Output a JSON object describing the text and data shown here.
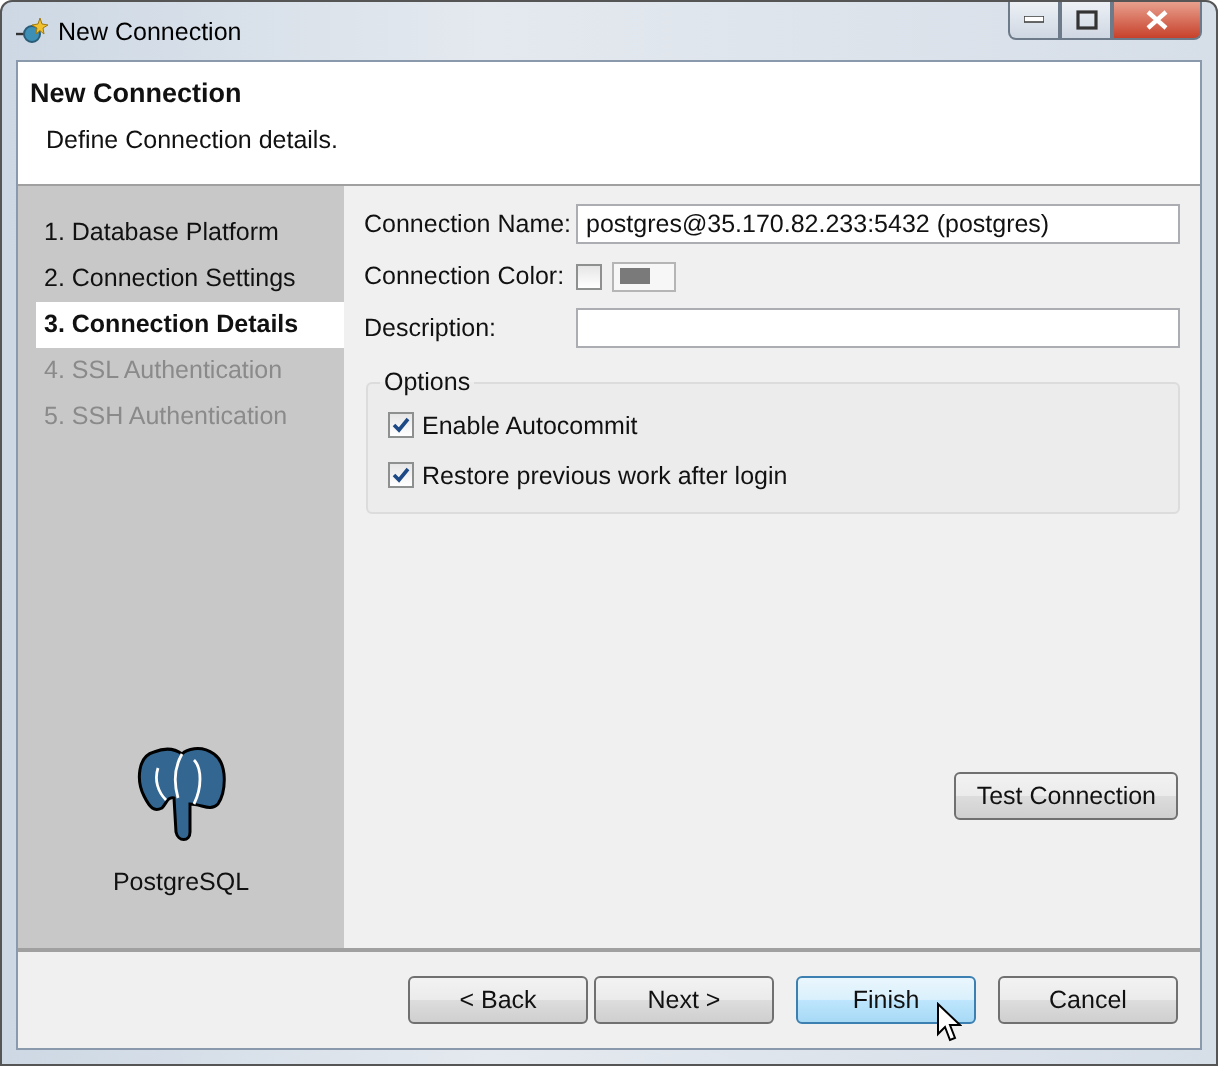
{
  "window": {
    "title": "New Connection"
  },
  "header": {
    "title": "New Connection",
    "description": "Define Connection details."
  },
  "steps": [
    {
      "label": "1. Database Platform",
      "selected": false,
      "disabled": false
    },
    {
      "label": "2. Connection Settings",
      "selected": false,
      "disabled": false
    },
    {
      "label": "3. Connection Details",
      "selected": true,
      "disabled": false
    },
    {
      "label": "4. SSL Authentication",
      "selected": false,
      "disabled": true
    },
    {
      "label": "5. SSH Authentication",
      "selected": false,
      "disabled": true
    }
  ],
  "platform": {
    "name": "PostgreSQL"
  },
  "form": {
    "connection_name": {
      "label": "Connection Name:",
      "value": "postgres@35.170.82.233:5432 (postgres)"
    },
    "connection_color": {
      "label": "Connection Color:",
      "checked": false
    },
    "description": {
      "label": "Description:"
    },
    "options": {
      "title": "Options",
      "items": [
        {
          "label": "Enable Autocommit",
          "checked": true
        },
        {
          "label": "Restore previous work after login",
          "checked": true
        }
      ]
    },
    "test_button": "Test Connection"
  },
  "buttons": [
    {
      "label": "< Back",
      "highlighted": false
    },
    {
      "label": "Next >",
      "highlighted": false
    },
    {
      "label": "Finish",
      "highlighted": true
    },
    {
      "label": "Cancel",
      "highlighted": false
    }
  ]
}
